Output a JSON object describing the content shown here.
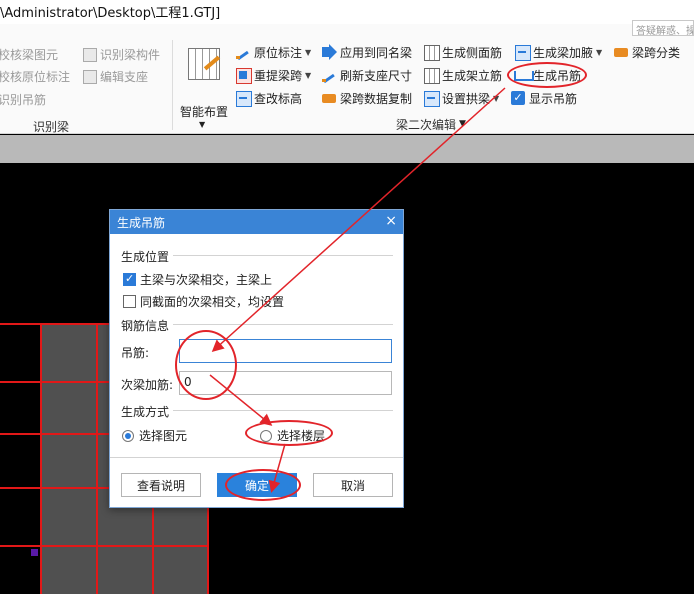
{
  "window": {
    "title": "\\Administrator\\Desktop\\工程1.GTJ]",
    "search_placeholder": "答疑解惑、操作..."
  },
  "ribbon": {
    "left_group": {
      "items": [
        "校核梁图元",
        "识别梁构件",
        "校核原位标注",
        "编辑支座",
        "识别吊筋"
      ],
      "label": "识别梁"
    },
    "smart_layout": {
      "label": "智能布置"
    },
    "edit_group": {
      "col1": [
        "原位标注",
        "重提梁跨",
        "查改标高"
      ],
      "col2": [
        "应用到同名梁",
        "刷新支座尺寸",
        "梁跨数据复制"
      ],
      "col3": [
        "生成侧面筋",
        "生成架立筋",
        "设置拱梁"
      ],
      "col4": [
        "生成梁加腋",
        "生成吊筋",
        "显示吊筋"
      ],
      "col5": [
        "梁跨分类"
      ],
      "label": "梁二次编辑"
    }
  },
  "dialog": {
    "title": "生成吊筋",
    "close_glyph": "×",
    "section_position": "生成位置",
    "option_main_secondary": "主梁与次梁相交，主梁上",
    "option_main_secondary_checked": true,
    "option_same_section": "同截面的次梁相交，均设置",
    "option_same_section_checked": false,
    "section_rebar": "钢筋信息",
    "hanger_label": "吊筋:",
    "hanger_value": "",
    "secondary_label": "次梁加筋:",
    "secondary_value": "0",
    "section_method": "生成方式",
    "method_element": "选择图元",
    "method_floor": "选择楼层",
    "method_selected": "element",
    "btn_help": "查看说明",
    "btn_ok": "确定",
    "btn_cancel": "取消"
  },
  "colors": {
    "dialog_title_bg": "#3a84d6",
    "primary_button": "#2a82dc",
    "annotation_red": "#e2242a",
    "canvas_bg": "#000000",
    "grid_line": "#e21818"
  },
  "icons": {
    "dropdown": "chevron-down-icon",
    "checked": "checkbox-checked-icon"
  }
}
